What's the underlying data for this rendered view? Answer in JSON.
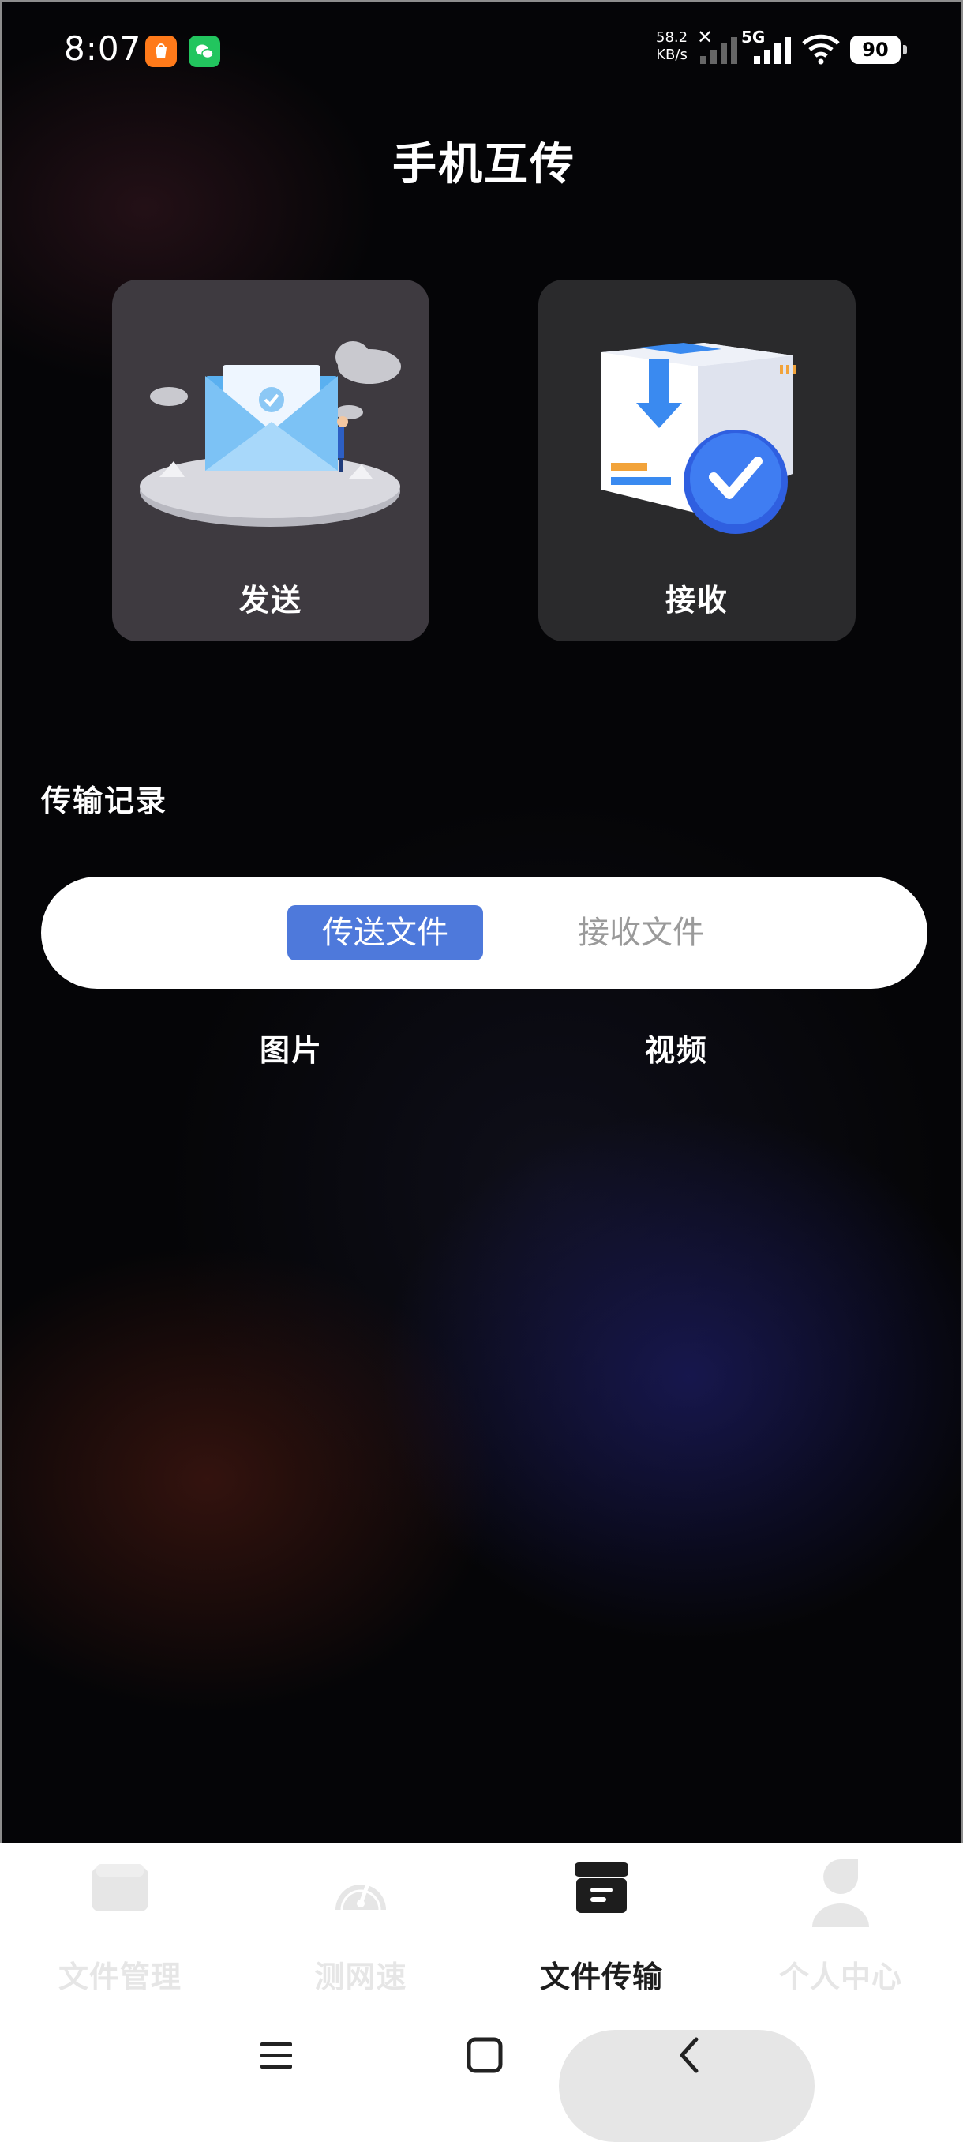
{
  "status_bar": {
    "time": "8:07",
    "net_speed_value": "58.2",
    "net_speed_unit": "KB/s",
    "network_type": "5G",
    "battery": "90"
  },
  "page": {
    "title": "手机互传"
  },
  "cards": {
    "send_label": "发送",
    "receive_label": "接收"
  },
  "records": {
    "title": "传输记录",
    "tabs": [
      {
        "label": "传送文件",
        "active": true
      },
      {
        "label": "接收文件",
        "active": false
      }
    ],
    "subtabs": [
      "图片",
      "视频"
    ]
  },
  "bottom_nav": {
    "items": [
      {
        "label": "文件管理",
        "icon": "folder-icon",
        "active": false
      },
      {
        "label": "测网速",
        "icon": "speedometer-icon",
        "active": false
      },
      {
        "label": "文件传输",
        "icon": "archive-box-icon",
        "active": true
      },
      {
        "label": "个人中心",
        "icon": "user-icon",
        "active": false
      }
    ]
  },
  "colors": {
    "accent": "#4e79db",
    "background": "#050507",
    "send_card": "#3e3a40",
    "receive_card": "#2a2a2c"
  }
}
